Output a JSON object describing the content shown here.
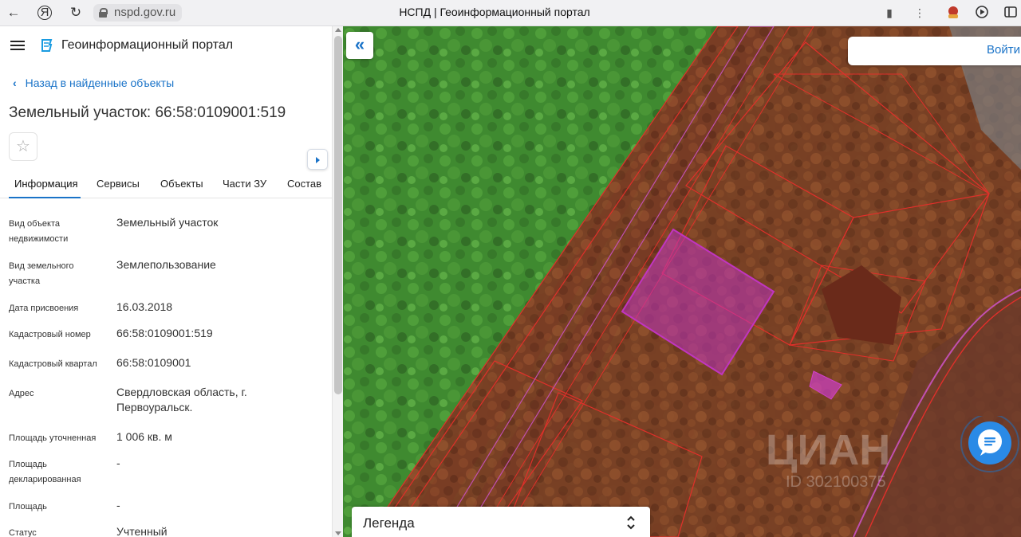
{
  "browser": {
    "url": "nspd.gov.ru",
    "page_title": "НСПД | Геоинформационный портал"
  },
  "header": {
    "portal_title": "Геоинформационный портал"
  },
  "nav": {
    "back_label": "Назад в найденные объекты"
  },
  "object": {
    "title": "Земельный участок: 66:58:0109001:519"
  },
  "tabs": [
    {
      "label": "Информация"
    },
    {
      "label": "Сервисы"
    },
    {
      "label": "Объекты"
    },
    {
      "label": "Части ЗУ"
    },
    {
      "label": "Состав"
    }
  ],
  "attributes": [
    {
      "label": "Вид объекта недвижимости",
      "value": "Земельный участок"
    },
    {
      "label": "Вид земельного участка",
      "value": "Землепользование"
    },
    {
      "label": "Дата присвоения",
      "value": "16.03.2018"
    },
    {
      "label": "Кадастровый номер",
      "value": "66:58:0109001:519"
    },
    {
      "label": "Кадастровый квартал",
      "value": "66:58:0109001"
    },
    {
      "label": "Адрес",
      "value": "Свердловская область, г. Первоуральск."
    },
    {
      "label": "Площадь уточненная",
      "value": "1 006 кв. м"
    },
    {
      "label": "Площадь декларированная",
      "value": "-"
    },
    {
      "label": "Площадь",
      "value": "-"
    },
    {
      "label": "Статус",
      "value": "Учтенный"
    }
  ],
  "map": {
    "login_label": "Войти",
    "legend_label": "Легенда",
    "watermark": "ЦИАН",
    "watermark_id": "ID 302100375"
  },
  "colors": {
    "accent": "#1a73c8",
    "parcel_selected": "#c035c0",
    "parcel_border": "#e0302a"
  }
}
